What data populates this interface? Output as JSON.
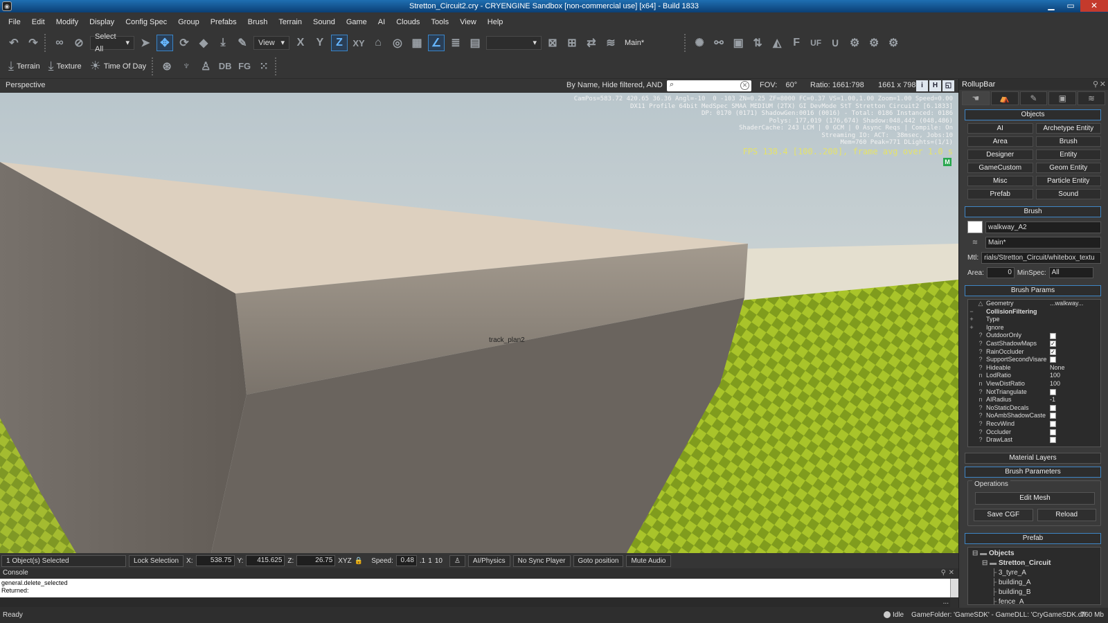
{
  "window": {
    "title": "Stretton_Circuit2.cry - CRYENGINE Sandbox [non-commercial use] [x64] - Build 1833"
  },
  "menu": [
    "File",
    "Edit",
    "Modify",
    "Display",
    "Config Spec",
    "Group",
    "Prefabs",
    "Brush",
    "Terrain",
    "Sound",
    "Game",
    "AI",
    "Clouds",
    "Tools",
    "View",
    "Help"
  ],
  "toolbar": {
    "select_all": "Select All",
    "view": "View",
    "x": "X",
    "y": "Y",
    "z": "Z",
    "xy": "XY",
    "layer": "Main*",
    "f": "F",
    "uf": "UF"
  },
  "toolbar2": {
    "terrain": "Terrain",
    "texture": "Texture",
    "time_of_day": "Time Of Day",
    "db": "DB",
    "fg": "FG"
  },
  "viewport": {
    "name": "Perspective",
    "filter": "By Name, Hide filtered, AND",
    "fov_label": "FOV:",
    "fov": "60°",
    "ratio_label": "Ratio:",
    "ratio": "1661:798",
    "resolution": "1661 x 798",
    "stats": "CamPos=583.72 420.65 36.36 Angl=-10  0 -103 ZN=0.25 ZF=8000 FC=0.37 VS=1.00,1.00 Zoom=1.00 Speed=0.00\nDX11 Profile 64bit MedSpec SMAA MEDIUM (2TX) GI DevMode StT Stretton Circuit2 [6.1833]\nDP: 0170 (0171) ShadowGen:0016 (0016) - Total: 0186 Instanced: 0186\nPolys: 177,019 (176,674) Shadow:048,442 (048,486)\nShaderCache: 243 LCM | 0 GCM | 0 Async Reqs | Compile: On\nStreaming IO: ACT:  38msec, Jobs:10\nMem=760 Peak=771 DLights=(1/1)",
    "fps": "FPS 138.4 [100..200], frame avg over 1.0 s",
    "badge": "M",
    "object_label": "track_plan2"
  },
  "rollup": {
    "title": "RollupBar",
    "objects_header": "Objects",
    "objects": [
      "AI",
      "Archetype Entity",
      "Area",
      "Brush",
      "Designer",
      "Entity",
      "GameCustom",
      "Geom Entity",
      "Misc",
      "Particle Entity",
      "Prefab",
      "Sound"
    ],
    "brush_header": "Brush",
    "brush_name": "walkway_A2",
    "brush_layer": "Main*",
    "mtl_label": "Mtl:",
    "mtl": "rials/Stretton_Circuit/whitebox_textu",
    "area_label": "Area:",
    "area": "0",
    "minspec_label": "MinSpec:",
    "minspec": "All",
    "params_header": "Brush Params",
    "params": [
      {
        "icon": "△",
        "name": "Geometry",
        "value": "...walkway..."
      },
      {
        "icon": "−",
        "name": "CollisionFiltering",
        "value": ""
      },
      {
        "icon": "+",
        "name": "Type",
        "value": ""
      },
      {
        "icon": "+",
        "name": "Ignore",
        "value": ""
      },
      {
        "icon": "?",
        "name": "OutdoorOnly",
        "value": "",
        "check": ""
      },
      {
        "icon": "?",
        "name": "CastShadowMaps",
        "value": "",
        "check": "✓"
      },
      {
        "icon": "?",
        "name": "RainOccluder",
        "value": "",
        "check": "✓"
      },
      {
        "icon": "?",
        "name": "SupportSecondVisare",
        "value": "",
        "check": ""
      },
      {
        "icon": "?",
        "name": "Hideable",
        "value": "None"
      },
      {
        "icon": "n",
        "name": "LodRatio",
        "value": "100"
      },
      {
        "icon": "n",
        "name": "ViewDistRatio",
        "value": "100"
      },
      {
        "icon": "?",
        "name": "NotTriangulate",
        "value": "",
        "check": ""
      },
      {
        "icon": "n",
        "name": "AIRadius",
        "value": "-1"
      },
      {
        "icon": "?",
        "name": "NoStaticDecals",
        "value": "",
        "check": ""
      },
      {
        "icon": "?",
        "name": "NoAmbShadowCaste",
        "value": "",
        "check": ""
      },
      {
        "icon": "?",
        "name": "RecvWind",
        "value": "",
        "check": ""
      },
      {
        "icon": "?",
        "name": "Occluder",
        "value": "",
        "check": ""
      },
      {
        "icon": "?",
        "name": "DrawLast",
        "value": "",
        "check": ""
      }
    ],
    "material_layers": "Material Layers",
    "brush_parameters": "Brush Parameters",
    "operations": "Operations",
    "edit_mesh": "Edit Mesh",
    "save_cgf": "Save CGF",
    "reload": "Reload",
    "prefab_header": "Prefab",
    "tree": [
      {
        "label": "Objects",
        "indent": 0,
        "bold": true
      },
      {
        "label": "Stretton_Circuit",
        "indent": 1,
        "bold": true
      },
      {
        "label": "3_tyre_A",
        "indent": 2
      },
      {
        "label": "building_A",
        "indent": 2
      },
      {
        "label": "building_B",
        "indent": 2
      },
      {
        "label": "fence_A",
        "indent": 2
      }
    ]
  },
  "status": {
    "selected": "1 Object(s) Selected",
    "lock": "Lock Selection",
    "x_label": "X:",
    "x": "538.75",
    "y_label": "Y:",
    "y": "415.625",
    "z_label": "Z:",
    "z": "26.75",
    "xyz": "XYZ",
    "speed_label": "Speed:",
    "speed": "0.48",
    "s1": ".1",
    "s2": "1",
    "s3": "10",
    "ai_physics": "AI/Physics",
    "no_sync": "No Sync Player",
    "goto": "Goto position",
    "mute": "Mute Audio"
  },
  "console": {
    "title": "Console",
    "lines": [
      "general.delete_selected",
      "Returned:"
    ],
    "more": "..."
  },
  "bottom": {
    "ready": "Ready",
    "idle": "Idle",
    "gamefolder": "GameFolder: 'GameSDK' - GameDLL: 'CryGameSDK.dll'",
    "mem": "760 Mb"
  },
  "colors": {
    "accent": "#3f86c6",
    "grass_a": "#a6c227",
    "grass_b": "#7f9a1c",
    "wall": "#6b655e",
    "top": "#ded1c0"
  }
}
